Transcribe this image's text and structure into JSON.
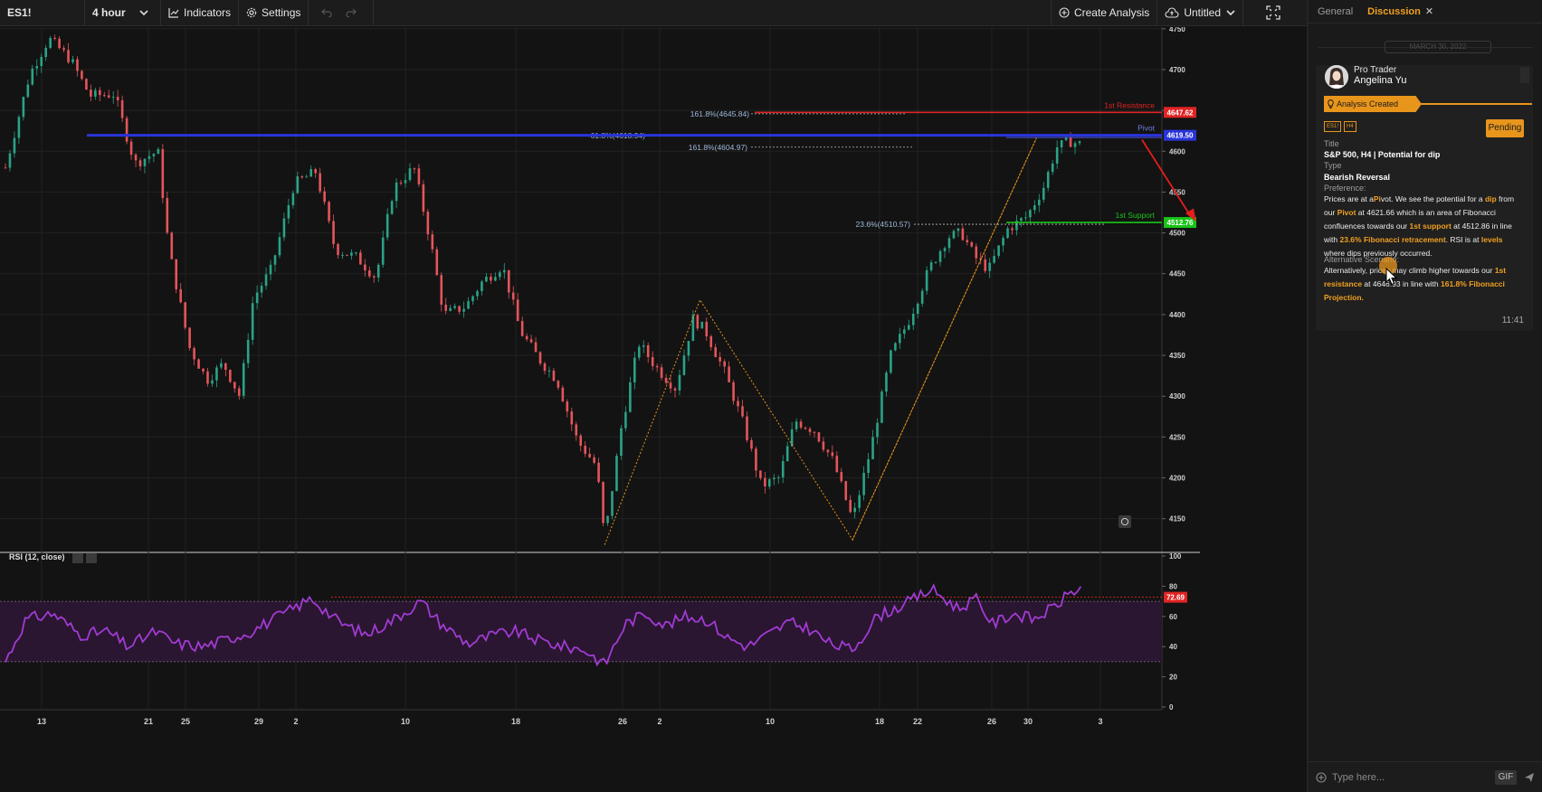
{
  "toolbar": {
    "symbol": "ES1!",
    "timeframe": "4 hour",
    "indicators_label": "Indicators",
    "settings_label": "Settings",
    "create_analysis_label": "Create Analysis",
    "layout_name": "Untitled"
  },
  "chart_data": [
    {
      "type": "candlestick",
      "symbol": "ES1!",
      "y_ticks": [
        4150,
        4200,
        4250,
        4300,
        4350,
        4400,
        4450,
        4500,
        4550,
        4600,
        4650,
        4700,
        4750
      ],
      "ylim": [
        4112,
        4752
      ],
      "x_tick_labels": [
        "13",
        "21",
        "25",
        "29",
        "2",
        "10",
        "18",
        "26",
        "2",
        "10",
        "18",
        "22",
        "26",
        "30",
        "3"
      ],
      "pivots": [
        {
          "t": 0,
          "p": 4580
        },
        {
          "t": 18,
          "p": 4695
        },
        {
          "t": 32,
          "p": 4738
        },
        {
          "t": 48,
          "p": 4712
        },
        {
          "t": 62,
          "p": 4668
        },
        {
          "t": 80,
          "p": 4670
        },
        {
          "t": 95,
          "p": 4585
        },
        {
          "t": 112,
          "p": 4600
        },
        {
          "t": 120,
          "p": 4480
        },
        {
          "t": 135,
          "p": 4360
        },
        {
          "t": 148,
          "p": 4320
        },
        {
          "t": 160,
          "p": 4340
        },
        {
          "t": 172,
          "p": 4300
        },
        {
          "t": 182,
          "p": 4420
        },
        {
          "t": 195,
          "p": 4455
        },
        {
          "t": 212,
          "p": 4560
        },
        {
          "t": 228,
          "p": 4575
        },
        {
          "t": 242,
          "p": 4480
        },
        {
          "t": 258,
          "p": 4470
        },
        {
          "t": 272,
          "p": 4445
        },
        {
          "t": 285,
          "p": 4555
        },
        {
          "t": 300,
          "p": 4580
        },
        {
          "t": 312,
          "p": 4490
        },
        {
          "t": 322,
          "p": 4400
        },
        {
          "t": 338,
          "p": 4410
        },
        {
          "t": 350,
          "p": 4440
        },
        {
          "t": 365,
          "p": 4460
        },
        {
          "t": 378,
          "p": 4380
        },
        {
          "t": 392,
          "p": 4345
        },
        {
          "t": 405,
          "p": 4320
        },
        {
          "t": 420,
          "p": 4245
        },
        {
          "t": 434,
          "p": 4215
        },
        {
          "t": 440,
          "p": 4125
        },
        {
          "t": 452,
          "p": 4260
        },
        {
          "t": 465,
          "p": 4365
        },
        {
          "t": 478,
          "p": 4335
        },
        {
          "t": 492,
          "p": 4310
        },
        {
          "t": 505,
          "p": 4395
        },
        {
          "t": 514,
          "p": 4380
        },
        {
          "t": 528,
          "p": 4330
        },
        {
          "t": 542,
          "p": 4265
        },
        {
          "t": 555,
          "p": 4190
        },
        {
          "t": 568,
          "p": 4200
        },
        {
          "t": 580,
          "p": 4270
        },
        {
          "t": 594,
          "p": 4258
        },
        {
          "t": 608,
          "p": 4220
        },
        {
          "t": 622,
          "p": 4148
        },
        {
          "t": 636,
          "p": 4240
        },
        {
          "t": 650,
          "p": 4350
        },
        {
          "t": 664,
          "p": 4395
        },
        {
          "t": 678,
          "p": 4455
        },
        {
          "t": 692,
          "p": 4495
        },
        {
          "t": 702,
          "p": 4500
        },
        {
          "t": 712,
          "p": 4470
        },
        {
          "t": 722,
          "p": 4455
        },
        {
          "t": 736,
          "p": 4505
        },
        {
          "t": 750,
          "p": 4520
        },
        {
          "t": 762,
          "p": 4555
        },
        {
          "t": 772,
          "p": 4605
        },
        {
          "t": 782,
          "p": 4612
        },
        {
          "t": 790,
          "p": 4608
        }
      ],
      "fib_levels": [
        {
          "label": "161.8%(4645.84)",
          "price": 4645.84
        },
        {
          "label": "-61.8%(4618.94)",
          "price": 4618.94
        },
        {
          "label": "161.8%(4604.97)",
          "price": 4604.97
        },
        {
          "label": "23.6%(4510.57)",
          "price": 4510.57
        }
      ],
      "lines": [
        {
          "name": "resistance",
          "label": "1st Resistance",
          "price": 4647.62,
          "price_label": "4647.62",
          "color": "#e02424"
        },
        {
          "name": "pivot",
          "label": "Pivot",
          "price": 4619.5,
          "price_label": "4619.50",
          "color": "#2a35d8"
        },
        {
          "name": "support",
          "label": "1st Support",
          "price": 4512.76,
          "price_label": "4512.76",
          "color": "#19c419"
        }
      ],
      "colors": {
        "up": "#2aa386",
        "down": "#e4555a",
        "fib": "#e8951c"
      }
    },
    {
      "type": "line",
      "title": "RSI (12, close)",
      "y_ticks": [
        0,
        20,
        40,
        60,
        80,
        100
      ],
      "ylim": [
        0,
        100
      ],
      "band": [
        30,
        70
      ],
      "current_value": 72.69,
      "current_label": "72.69",
      "pivots": [
        {
          "t": 0,
          "v": 30
        },
        {
          "t": 15,
          "v": 58
        },
        {
          "t": 35,
          "v": 62
        },
        {
          "t": 55,
          "v": 48
        },
        {
          "t": 75,
          "v": 50
        },
        {
          "t": 90,
          "v": 40
        },
        {
          "t": 110,
          "v": 50
        },
        {
          "t": 125,
          "v": 42
        },
        {
          "t": 145,
          "v": 40
        },
        {
          "t": 160,
          "v": 44
        },
        {
          "t": 180,
          "v": 50
        },
        {
          "t": 205,
          "v": 62
        },
        {
          "t": 225,
          "v": 72
        },
        {
          "t": 245,
          "v": 56
        },
        {
          "t": 265,
          "v": 48
        },
        {
          "t": 285,
          "v": 58
        },
        {
          "t": 305,
          "v": 70
        },
        {
          "t": 320,
          "v": 55
        },
        {
          "t": 340,
          "v": 42
        },
        {
          "t": 360,
          "v": 48
        },
        {
          "t": 375,
          "v": 50
        },
        {
          "t": 392,
          "v": 44
        },
        {
          "t": 410,
          "v": 40
        },
        {
          "t": 425,
          "v": 38
        },
        {
          "t": 440,
          "v": 28
        },
        {
          "t": 455,
          "v": 55
        },
        {
          "t": 470,
          "v": 62
        },
        {
          "t": 485,
          "v": 54
        },
        {
          "t": 500,
          "v": 60
        },
        {
          "t": 515,
          "v": 58
        },
        {
          "t": 530,
          "v": 46
        },
        {
          "t": 545,
          "v": 40
        },
        {
          "t": 560,
          "v": 48
        },
        {
          "t": 575,
          "v": 56
        },
        {
          "t": 590,
          "v": 52
        },
        {
          "t": 605,
          "v": 42
        },
        {
          "t": 622,
          "v": 38
        },
        {
          "t": 640,
          "v": 60
        },
        {
          "t": 660,
          "v": 68
        },
        {
          "t": 680,
          "v": 78
        },
        {
          "t": 700,
          "v": 65
        },
        {
          "t": 712,
          "v": 72
        },
        {
          "t": 725,
          "v": 55
        },
        {
          "t": 740,
          "v": 62
        },
        {
          "t": 755,
          "v": 58
        },
        {
          "t": 770,
          "v": 66
        },
        {
          "t": 782,
          "v": 76
        },
        {
          "t": 790,
          "v": 79
        }
      ],
      "color": "#a13bd4"
    }
  ],
  "panel": {
    "tabs": [
      {
        "label": "General"
      },
      {
        "label": "Discussion"
      }
    ],
    "date_divider": "MARCH 30, 2022",
    "message": {
      "author_role": "Pro Trader",
      "author_name": "Angelina Yu",
      "created_label": "Analysis Created",
      "chip_symbol": "ES1!",
      "chip_tf": "H4",
      "status": "Pending",
      "title_label": "Title",
      "title_value": "S&P 500, H4 | Potential for dip",
      "type_label": "Type",
      "type_value": "Bearish Reversal",
      "preference_label": "Preference:",
      "preference_parts": [
        {
          "text": "Prices are at a",
          "hl": false
        },
        {
          "text": "Pi",
          "hl": true
        },
        {
          "text": "vot. We see the potential for a ",
          "hl": false
        },
        {
          "text": "dip",
          "hl": true
        },
        {
          "text": " from our ",
          "hl": false
        },
        {
          "text": "Pivot",
          "hl": true
        },
        {
          "text": " at 4621.66 which is an area of Fibonacci confluences towards our ",
          "hl": false
        },
        {
          "text": "1st support",
          "hl": true
        },
        {
          "text": " at 4512.86 in line with ",
          "hl": false
        },
        {
          "text": "23.6% Fibonacci retracement",
          "hl": true
        },
        {
          "text": ". RSI is at ",
          "hl": false
        },
        {
          "text": "levels",
          "hl": true
        },
        {
          "text": " where dips previously occurred.",
          "hl": false
        }
      ],
      "alt_label": "Alternative Scenario:",
      "alt_parts": [
        {
          "text": "Alternatively, prices may climb higher towards our ",
          "hl": false
        },
        {
          "text": "1st resistance",
          "hl": true
        },
        {
          "text": " at 4646.93 in line with ",
          "hl": false
        },
        {
          "text": "161.8% Fibonacci Projection.",
          "hl": true
        }
      ],
      "time": "11:41"
    },
    "composer": {
      "placeholder": "Type here...",
      "gif_label": "GIF"
    }
  }
}
